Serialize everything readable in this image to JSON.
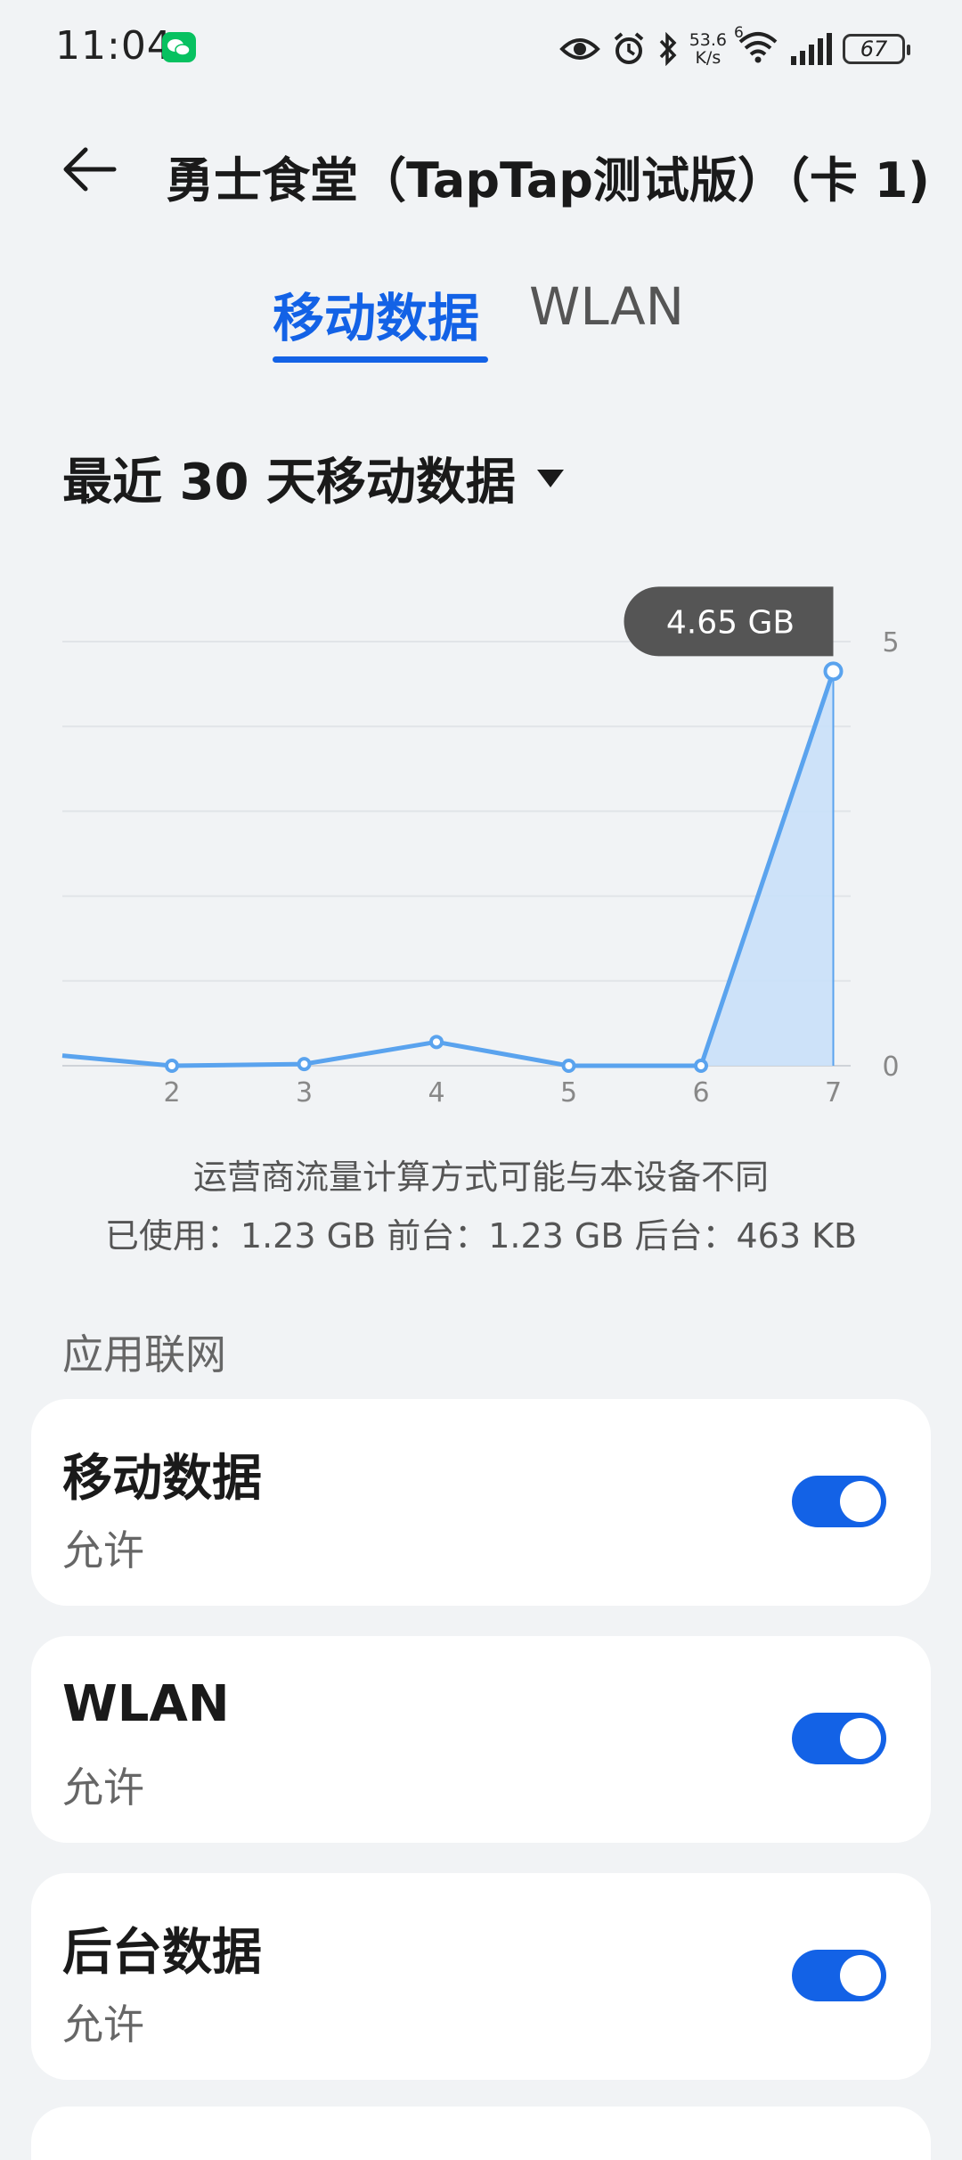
{
  "status_bar": {
    "time": "11:04",
    "net_speed_value": "53.6",
    "net_speed_unit": "K/s",
    "wifi_badge": "6",
    "battery": "67",
    "icons": [
      "wechat-icon",
      "eye-icon",
      "alarm-icon",
      "bluetooth-icon",
      "wifi-icon",
      "signal-icon",
      "battery-icon"
    ]
  },
  "header": {
    "title": "勇士食堂（TapTap测试版）（卡 1)"
  },
  "tabs": [
    {
      "label": "移动数据",
      "active": true
    },
    {
      "label": "WLAN",
      "active": false
    }
  ],
  "period": {
    "label": "最近 30 天移动数据"
  },
  "chart_data": {
    "type": "area",
    "x": [
      1,
      2,
      3,
      4,
      5,
      6,
      7
    ],
    "y": [
      0.12,
      0.0,
      0.02,
      0.28,
      0.0,
      0.0,
      4.65
    ],
    "x_tick_labels": [
      "2",
      "3",
      "4",
      "5",
      "6",
      "7"
    ],
    "y_tick_labels": [
      "5",
      "0"
    ],
    "ylim": [
      0,
      5
    ],
    "tooltip": "4.65 GB",
    "grid": true,
    "color": "#5aa3ee"
  },
  "notes": {
    "line1": "运营商流量计算方式可能与本设备不同",
    "line2": "已使用：1.23 GB 前台：1.23 GB 后台：463 KB"
  },
  "section": {
    "title": "应用联网"
  },
  "settings": [
    {
      "title": "移动数据",
      "status": "允许",
      "enabled": true
    },
    {
      "title": "WLAN",
      "status": "允许",
      "enabled": true
    },
    {
      "title": "后台数据",
      "status": "允许",
      "enabled": true
    }
  ],
  "colors": {
    "accent": "#1362e6",
    "background": "#f1f3f5",
    "chart_line": "#5aa3ee"
  }
}
